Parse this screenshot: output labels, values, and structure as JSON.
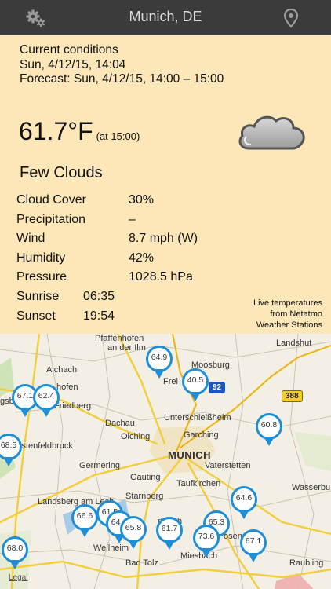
{
  "nav": {
    "title": "Munich, DE",
    "left_icon": "gear-icon",
    "right_icon": "location-pin-icon"
  },
  "current": {
    "heading": "Current conditions",
    "datetime": "Sun, 4/12/15, 14:04",
    "forecast": "Forecast:  Sun, 4/12/15, 14:00 – 15:00",
    "temperature": "61.7°F",
    "temp_time": "(at 15:00)",
    "condition": "Few Clouds",
    "condition_icon": "cloud-icon"
  },
  "details": [
    {
      "label": "Cloud Cover",
      "value": "30%"
    },
    {
      "label": "Precipitation",
      "value": "–"
    },
    {
      "label": "Wind",
      "value": "8.7 mph (W)"
    },
    {
      "label": "Humidity",
      "value": "42%"
    },
    {
      "label": "Pressure",
      "value": "1028.5 hPa"
    }
  ],
  "sun": [
    {
      "label": "Sunrise",
      "value": "06:35"
    },
    {
      "label": "Sunset",
      "value": "19:54"
    }
  ],
  "note": {
    "line1": "Live temperatures",
    "line2": "from Netatmo",
    "line3": "Weather Stations"
  },
  "map": {
    "labels": {
      "pfaffenhofen1": "Pfaffenhofen",
      "pfaffenhofen2": "an der Ilm",
      "landshut": "Landshut",
      "aichach": "Aichach",
      "hofen": "hofen",
      "friedberg": "Friedberg",
      "moosburg": "Moosburg",
      "freising": "Frei",
      "gsb": "gsb",
      "dachau": "Dachau",
      "unterschl": "Unterschleißheim",
      "garching": "Garching",
      "olching": "Olching",
      "fuerstenfeld": "Fürstenfeldbruck",
      "munich": "MUNICH",
      "germering": "Germering",
      "vaterstetten": "Vaterstetten",
      "gauting": "Gauting",
      "taufkirchen": "Taufkirchen",
      "landsberg": "Landsberg am Lech",
      "starnberg": "Starnberg",
      "wasserbu": "Wasserbu",
      "weilheim": "Weilheim",
      "miesbach": "Miesbach",
      "badtolz": "Bad Tolz",
      "raubling": "Raubling",
      "rosen": "osen",
      "rfratsh": "rfratsh",
      "legal": "Legal"
    },
    "shields": {
      "a92": "92",
      "b388": "388"
    },
    "pins": [
      {
        "value": "64.9"
      },
      {
        "value": "40.5"
      },
      {
        "value": "67.1"
      },
      {
        "value": "62.4"
      },
      {
        "value": "60.8"
      },
      {
        "value": "68.5"
      },
      {
        "value": "64.6"
      },
      {
        "value": "66.6"
      },
      {
        "value": "61.5"
      },
      {
        "value": "64.1"
      },
      {
        "value": "65.8"
      },
      {
        "value": "61.7"
      },
      {
        "value": "65.3"
      },
      {
        "value": "73.6"
      },
      {
        "value": "67.1"
      },
      {
        "value": "68.0"
      }
    ]
  }
}
